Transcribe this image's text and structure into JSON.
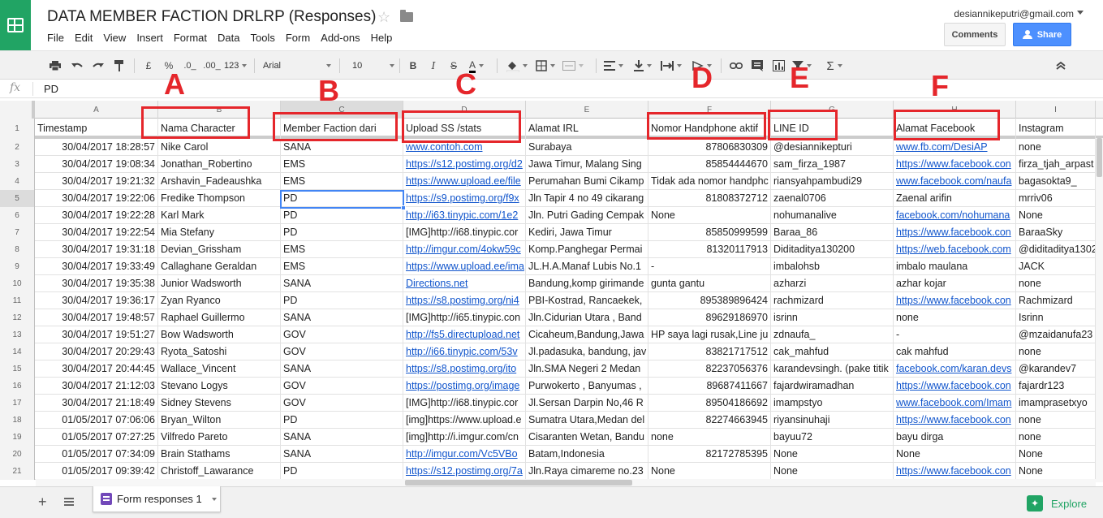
{
  "title_bar": {
    "document_title": "DATA MEMBER FACTION DRLRP (Responses)",
    "user_email": "desiannikeputri@gmail.com",
    "comments_label": "Comments",
    "share_label": "Share",
    "menu": [
      "File",
      "Edit",
      "View",
      "Insert",
      "Format",
      "Data",
      "Tools",
      "Form",
      "Add-ons",
      "Help"
    ]
  },
  "toolbar": {
    "currency": "£",
    "percent": "%",
    "decimal_decrease": ".0_",
    "decimal_increase": ".00_",
    "more_formats": "123",
    "font": "Arial",
    "font_size": "10",
    "bold": "B",
    "italic": "I",
    "strike": "S",
    "text_color": "A",
    "sigma": "Σ"
  },
  "formula_bar": {
    "fx_label": "fx",
    "value": "PD"
  },
  "columns": [
    "A",
    "B",
    "C",
    "D",
    "E",
    "F",
    "G",
    "H",
    "I"
  ],
  "selected_column": "C",
  "row_numbers": [
    "1",
    "2",
    "3",
    "4",
    "5",
    "6",
    "7",
    "8",
    "9",
    "10",
    "11",
    "12",
    "13",
    "14",
    "15",
    "16",
    "17",
    "18",
    "19",
    "20",
    "21"
  ],
  "selected_row": "5",
  "headers": [
    "Timestamp",
    "Nama Character",
    "Member Faction dari",
    "Upload SS /stats",
    "Alamat IRL",
    "Nomor Handphone aktif",
    "LINE ID",
    "Alamat Facebook",
    "Instagram"
  ],
  "rows": [
    [
      "30/04/2017 18:28:57",
      "Nike Carol",
      "SANA",
      "www.contoh.com",
      "Surabaya",
      "87806830309",
      "@desiannikepturi",
      "www.fb.com/DesiAP",
      "none"
    ],
    [
      "30/04/2017 19:08:34",
      "Jonathan_Robertino",
      "EMS",
      "https://s12.postimg.org/d2",
      "Jawa Timur, Malang Sing",
      "85854444670",
      "sam_firza_1987",
      "https://www.facebook.con",
      "firza_tjah_arpast"
    ],
    [
      "30/04/2017 19:21:32",
      "Arshavin_Fadeaushka",
      "EMS",
      "https://www.upload.ee/file",
      "Perumahan Bumi Cikamp",
      "Tidak ada nomor handphc",
      "riansyahpambudi29",
      "www.facebook.com/naufa",
      "bagasokta9_"
    ],
    [
      "30/04/2017 19:22:06",
      "Fredike Thompson",
      "PD",
      "https://s9.postimg.org/f9x",
      "Jln Tapir 4 no 49 cikarang",
      "81808372712",
      "zaenal0706",
      "Zaenal arifin",
      "mrriv06"
    ],
    [
      "30/04/2017 19:22:28",
      "Karl Mark",
      "PD",
      "http://i63.tinypic.com/1e2",
      "Jln. Putri Gading Cempak",
      "None",
      "nohumanalive",
      "facebook.com/nohumana",
      "None"
    ],
    [
      "30/04/2017 19:22:54",
      "Mia Stefany",
      "PD",
      "[IMG]http://i68.tinypic.cor",
      "Kediri, Jawa Timur",
      "85850999599",
      "Baraa_86",
      "https://www.facebook.con",
      "BaraaSky"
    ],
    [
      "30/04/2017 19:31:18",
      "Devian_Grissham",
      "EMS",
      "http://imgur.com/4okw59c",
      "Komp.Panghegar Permai",
      "81320117913",
      "Diditaditya130200",
      "https://web.facebook.com",
      "@diditaditya1302"
    ],
    [
      "30/04/2017 19:33:49",
      "Callaghane Geraldan",
      "EMS",
      "https://www.upload.ee/ima",
      "JL.H.A.Manaf Lubis No.1",
      "-",
      "imbalohsb",
      "imbalo maulana",
      "JACK"
    ],
    [
      "30/04/2017 19:35:38",
      "Junior Wadsworth",
      "SANA",
      "Directions.net",
      "Bandung,komp girimande",
      "gunta gantu",
      "azharzi",
      "azhar kojar",
      "none"
    ],
    [
      "30/04/2017 19:36:17",
      "Zyan Ryanco",
      "PD",
      "https://s8.postimg.org/ni4",
      "PBI-Kostrad, Rancaekek,",
      "895389896424",
      "rachmizard",
      "https://www.facebook.con",
      "Rachmizard"
    ],
    [
      "30/04/2017 19:48:57",
      "Raphael Guillermo",
      "SANA",
      "[IMG]http://i65.tinypic.con",
      "Jln.Cidurian Utara , Band",
      "89629186970",
      "isrinn",
      "none",
      "Isrinn"
    ],
    [
      "30/04/2017 19:51:27",
      "Bow Wadsworth",
      "GOV",
      "http://fs5.directupload.net",
      "Cicaheum,Bandung,Jawa",
      "HP saya lagi rusak,Line ju",
      "zdnaufa_",
      "-",
      "@mzaidanufa23"
    ],
    [
      "30/04/2017 20:29:43",
      "Ryota_Satoshi",
      "GOV",
      "http://i66.tinypic.com/53v",
      "Jl.padasuka, bandung, jav",
      "83821717512",
      "cak_mahfud",
      "cak mahfud",
      "none"
    ],
    [
      "30/04/2017 20:44:45",
      "Wallace_Vincent",
      "SANA",
      "https://s8.postimg.org/ito",
      "Jln.SMA Negeri 2 Medan",
      "82237056376",
      "karandevsingh. (pake titik",
      "facebook.com/karan.devs",
      "@karandev7"
    ],
    [
      "30/04/2017 21:12:03",
      "Stevano Logys",
      "GOV",
      "https://postimg.org/image",
      "Purwokerto , Banyumas ,",
      "89687411667",
      "fajardwiramadhan",
      "https://www.facebook.con",
      "fajardr123"
    ],
    [
      "30/04/2017 21:18:49",
      "Sidney Stevens",
      "GOV",
      "[IMG]http://i68.tinypic.cor",
      "Jl.Sersan Darpin No,46 R",
      "89504186692",
      "imampstyo",
      "www.facebook.com/Imam",
      "imamprasetxyo"
    ],
    [
      "01/05/2017 07:06:06",
      "Bryan_Wilton",
      "PD",
      "[img]https://www.upload.e",
      "Sumatra Utara,Medan del",
      "82274663945",
      "riyansinuhaji",
      "https://www.facebook.con",
      "none"
    ],
    [
      "01/05/2017 07:27:25",
      "Vilfredo Pareto",
      "SANA",
      "[img]http://i.imgur.com/cn",
      "Cisaranten Wetan, Bandu",
      "none",
      "bayuu72",
      "bayu dirga",
      "none"
    ],
    [
      "01/05/2017 07:34:09",
      "Brain Stathams",
      "SANA",
      "http://imgur.com/Vc5VBo",
      "Batam,Indonesia",
      "82172785395",
      "None",
      "None",
      "None"
    ],
    [
      "01/05/2017 09:39:42",
      "Christoff_Lawarance",
      "PD",
      "https://s12.postimg.org/7a",
      "Jln.Raya cimareme no.23",
      "None",
      "None",
      "https://www.facebook.con",
      "None"
    ]
  ],
  "annotations": [
    "A",
    "B",
    "C",
    "D",
    "E",
    "F"
  ],
  "bottom_bar": {
    "sheet_tab_label": "Form responses 1",
    "explore_label": "Explore"
  },
  "colors": {
    "brand_green": "#21a464",
    "share_blue": "#4d90fe",
    "link_blue": "#1155cc",
    "annotation_red": "#e5262b",
    "selection_blue": "#4285f4"
  }
}
